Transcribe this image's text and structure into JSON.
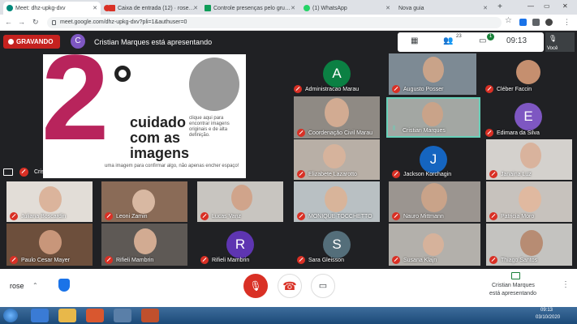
{
  "browser": {
    "tabs": [
      {
        "title": "Meet: dhz-upkg-dxv",
        "color": "#00897b"
      },
      {
        "title": "",
        "color": "#d93025"
      },
      {
        "title": "Caixa de entrada (12) · rose…",
        "color": "#d93025"
      },
      {
        "title": "Controle presenças pelo gru…",
        "color": "#0f9d58"
      },
      {
        "title": "(1) WhatsApp",
        "color": "#25d366"
      },
      {
        "title": "Nova guia",
        "color": "#9aa0a6"
      }
    ],
    "url": "meet.google.com/dhz-upkg-dxv?pli=1&authuser=0"
  },
  "meet": {
    "recording": "GRAVANDO",
    "presenter_initial": "C",
    "presenting": "Cristian Marques está apresentando",
    "people_count": "23",
    "chat_count": "1",
    "clock": "09:13",
    "you_label": "Você"
  },
  "slide": {
    "big": "2",
    "title": "cuidado com as imagens",
    "subtitle": "clique aqui para encontrar imagens originais e de alta definição.",
    "footer": "uma imagem para confirmar algo, não apenas encher espaço!"
  },
  "presenter_label": "Cristian Marques",
  "participants": [
    {
      "name": "Administracao Marau",
      "initial": "A",
      "color": "#0b8043"
    },
    {
      "name": "Augusto Posser"
    },
    {
      "name": "Cléber Faccin"
    },
    {
      "name": "Coordenação Civil Marau"
    },
    {
      "name": "Cristian Marques"
    },
    {
      "name": "Edimara da Silva",
      "initial": "E",
      "color": "#7e57c2"
    },
    {
      "name": "Elizabete Lazarotto"
    },
    {
      "name": "Jackson Korchagin",
      "initial": "J",
      "color": "#1565c0"
    },
    {
      "name": "Janaina Luz"
    },
    {
      "name": "Juliana Boscardin"
    },
    {
      "name": "Leoni Zamin"
    },
    {
      "name": "Lucas Vanz"
    },
    {
      "name": "MONIQUE TOCCHETTO"
    },
    {
      "name": "Nauro Mittmann"
    },
    {
      "name": "Patricia Moro"
    },
    {
      "name": "Paulo Cesar Mayer"
    },
    {
      "name": "Rifieli Mambrin"
    },
    {
      "name": "Rifieli Mambrin",
      "initial": "R",
      "color": "#5e35b1"
    },
    {
      "name": "Sara Gleisson",
      "initial": "S",
      "color": "#546e7a"
    },
    {
      "name": "Susana Klajn"
    },
    {
      "name": "Thiago Santos"
    }
  ],
  "bottom": {
    "user": "rose",
    "presenting_name": "Cristian Marques",
    "presenting_label": "está apresentando"
  },
  "taskbar": {
    "time": "09:13",
    "date": "03/10/2020"
  }
}
